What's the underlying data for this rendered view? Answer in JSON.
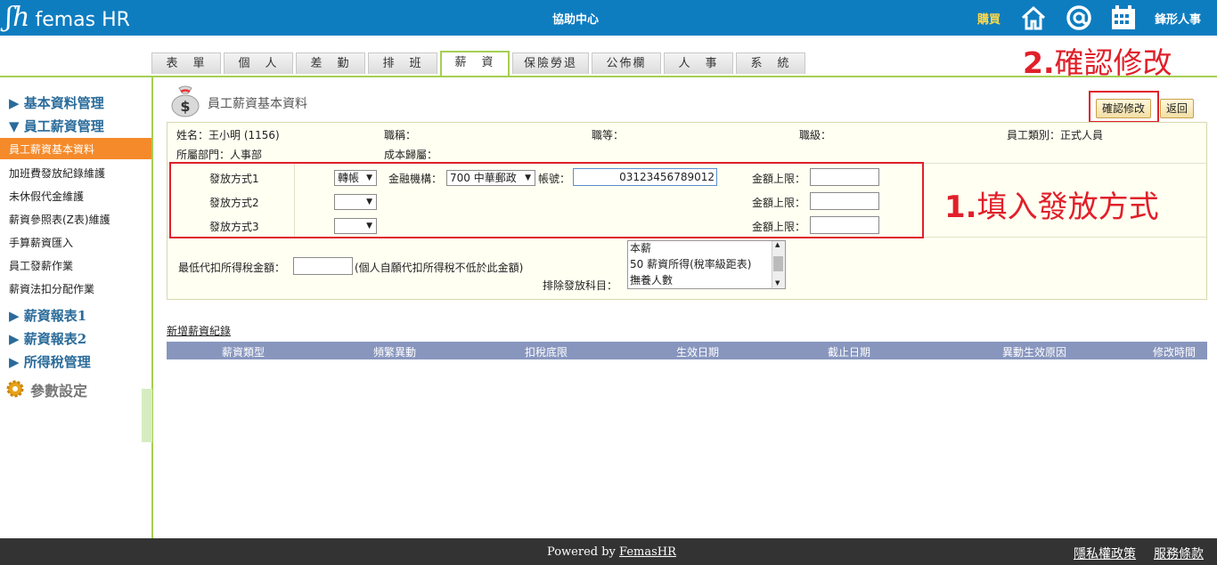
{
  "header": {
    "brand": "femas HR",
    "center_title": "協助中心",
    "buy_label": "購買",
    "user_label": "鋒形人事"
  },
  "tabs": [
    "表　單",
    "個　人",
    "差　勤",
    "排　班",
    "薪　資",
    "保險勞退",
    "公佈欄",
    "人　事",
    "系　統"
  ],
  "active_tab_index": 4,
  "sidebar": {
    "sections": [
      "▶ 基本資料管理",
      "▼ 員工薪資管理"
    ],
    "items": [
      "員工薪資基本資料",
      "加班費發放紀錄維護",
      "未休假代金維護",
      "薪資參照表(Z表)維護",
      "手算薪資匯入",
      "員工發薪作業",
      "薪資法扣分配作業"
    ],
    "active_item_index": 0,
    "lower_sections": [
      "▶ 薪資報表1",
      "▶ 薪資報表2",
      "▶ 所得稅管理"
    ],
    "settings_label": "參數設定"
  },
  "page": {
    "title": "員工薪資基本資料",
    "confirm_button": "確認修改",
    "back_button": "返回"
  },
  "employee": {
    "name_label": "姓名：",
    "name_value": "王小明 (1156)",
    "title_label": "職稱：",
    "grade_label": "職等：",
    "level_label": "職級：",
    "type_label": "員工類別：",
    "type_value": "正式人員",
    "dept_label": "所屬部門：",
    "dept_value": "人事部",
    "cost_label": "成本歸屬："
  },
  "payment": {
    "method1_label": "發放方式1",
    "method2_label": "發放方式2",
    "method3_label": "發放方式3",
    "method1_value": "轉帳",
    "bank_label": "金融機構：",
    "bank_value": "700 中華郵政",
    "account_label": "帳號：",
    "account_value": "03123456789012",
    "limit_label": "金額上限："
  },
  "tax": {
    "min_label": "最低代扣所得稅金額：",
    "min_note": "(個人自願代扣所得稅不低於此金額)",
    "exclude_label": "排除發放科目：",
    "exclude_options": [
      "本薪",
      "50 薪資所得(稅率級距表)",
      "撫養人數"
    ]
  },
  "records": {
    "add_link": "新增薪資紀錄",
    "columns": [
      "薪資類型",
      "頻繁異動",
      "扣稅底限",
      "生效日期",
      "截止日期",
      "異動生效原因",
      "修改時間"
    ]
  },
  "annotations": {
    "step1_num": "1.",
    "step1_text": "填入發放方式",
    "step2_num": "2.",
    "step2_text": "確認修改"
  },
  "footer": {
    "powered_by": "Powered by",
    "brand_link": "FemasHR",
    "privacy": "隱私權政策",
    "terms": "服務條款"
  },
  "colors": {
    "topbar": "#0e7dc0",
    "accent_green": "#a5cf52",
    "active_orange": "#f48a2a",
    "annotation_red": "#e0202a",
    "table_header": "#8896be"
  }
}
